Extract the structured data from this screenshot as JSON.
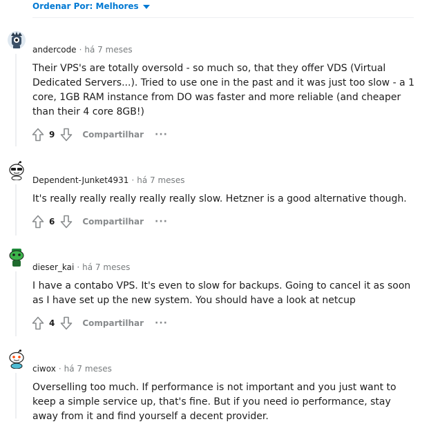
{
  "sort": {
    "label": "Ordenar Por: Melhores"
  },
  "actions_labels": {
    "share": "Compartilhar",
    "more": "···"
  },
  "comments": [
    {
      "author": "andercode",
      "time": "há 7 meses",
      "text": "Their VPS's are totally oversold - so much so, that they offer VDS (Virtual Dedicated Servers...). Tried to use one in the past and it was just too slow - a 1 core, 1GB RAM instance from DO was faster and more reliable (and cheaper than their 4 core 8GB!)",
      "score": "9"
    },
    {
      "author": "Dependent-Junket4931",
      "time": "há 7 meses",
      "text": "It's really really really really really slow. Hetzner is a good alternative though.",
      "score": "6"
    },
    {
      "author": "dieser_kai",
      "time": "há 7 meses",
      "text": "I have a contabo VPS. It's even to slow for backups. Going to cancel it as soon as I have set up the new system. You should have a look at netcup",
      "score": "4"
    },
    {
      "author": "ciwox",
      "time": "há 7 meses",
      "text": "Overselling too much. If performance is not important and you just want to keep a simple service up, that's fine. But if you need io performance, stay away from it and find yourself a decent provider."
    }
  ]
}
